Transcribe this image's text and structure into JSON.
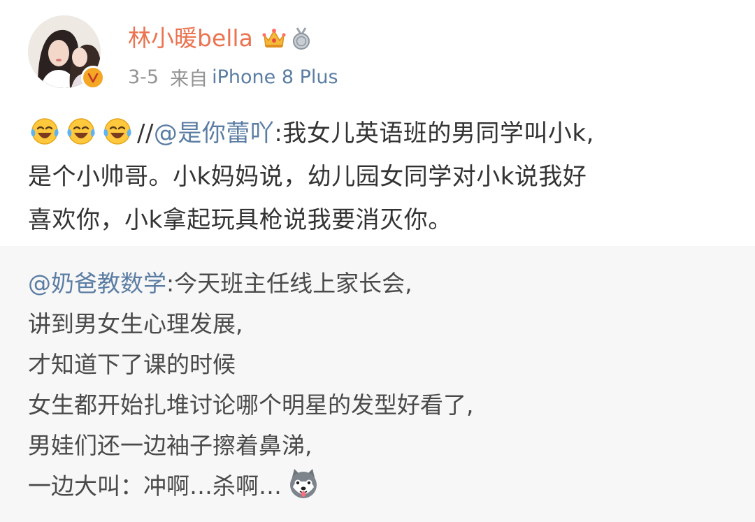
{
  "user": {
    "name": "林小暖bella",
    "avatar_icon": "avatar-photo",
    "verified_icon": "verified-v-icon",
    "badges": [
      "crown-icon",
      "medal-icon"
    ],
    "time": "3-5",
    "source_label": "来自",
    "device": "iPhone 8 Plus"
  },
  "post": {
    "emoji_icon": "laugh-cry-emoji",
    "emoji_count": 3,
    "slashes": "//",
    "mention": "@是你蕾吖",
    "line1": ":我女儿英语班的男同学叫小k,",
    "line2": "是个小帅哥。小k妈妈说，幼儿园女同学对小k说我好",
    "line3": "喜欢你，小k拿起玩具枪说我要消灭你。"
  },
  "quoted": {
    "mention": "@奶爸教数学",
    "line1_rest": ":今天班主任线上家长会,",
    "line2": "讲到男女生心理发展,",
    "line3": "才知道下了课的时候",
    "line4": "女生都开始扎堆讨论哪个明星的发型好看了,",
    "line5": "男娃们还一边袖子擦着鼻涕,",
    "line6": "一边大叫：冲啊…杀啊…",
    "end_icon": "husky-dog-emoji"
  },
  "colors": {
    "username": "#eb7350",
    "link": "#5b7da3",
    "meta": "#939393",
    "text": "#333333",
    "quoted_bg": "#f7f7f7"
  }
}
